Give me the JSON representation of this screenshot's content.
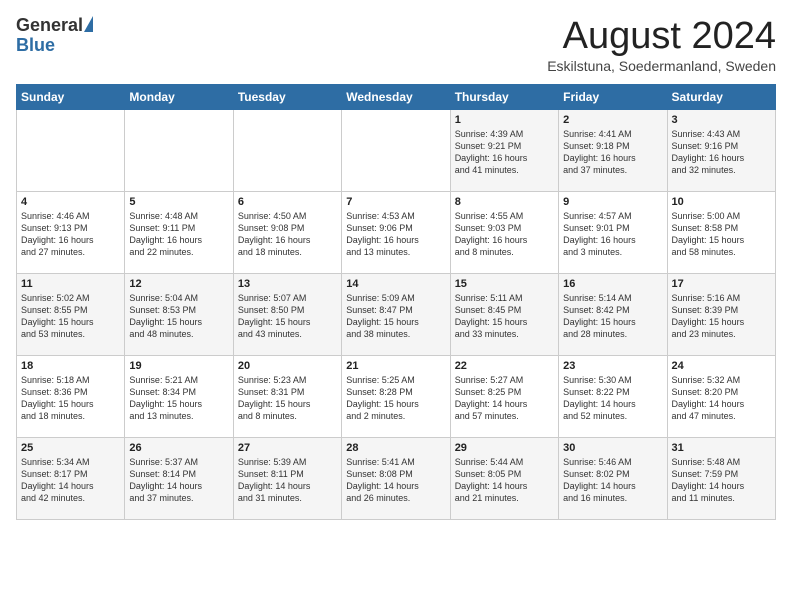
{
  "header": {
    "logo_general": "General",
    "logo_blue": "Blue",
    "title": "August 2024",
    "location": "Eskilstuna, Soedermanland, Sweden"
  },
  "days_of_week": [
    "Sunday",
    "Monday",
    "Tuesday",
    "Wednesday",
    "Thursday",
    "Friday",
    "Saturday"
  ],
  "weeks": [
    [
      {
        "day": "",
        "info": ""
      },
      {
        "day": "",
        "info": ""
      },
      {
        "day": "",
        "info": ""
      },
      {
        "day": "",
        "info": ""
      },
      {
        "day": "1",
        "info": "Sunrise: 4:39 AM\nSunset: 9:21 PM\nDaylight: 16 hours\nand 41 minutes."
      },
      {
        "day": "2",
        "info": "Sunrise: 4:41 AM\nSunset: 9:18 PM\nDaylight: 16 hours\nand 37 minutes."
      },
      {
        "day": "3",
        "info": "Sunrise: 4:43 AM\nSunset: 9:16 PM\nDaylight: 16 hours\nand 32 minutes."
      }
    ],
    [
      {
        "day": "4",
        "info": "Sunrise: 4:46 AM\nSunset: 9:13 PM\nDaylight: 16 hours\nand 27 minutes."
      },
      {
        "day": "5",
        "info": "Sunrise: 4:48 AM\nSunset: 9:11 PM\nDaylight: 16 hours\nand 22 minutes."
      },
      {
        "day": "6",
        "info": "Sunrise: 4:50 AM\nSunset: 9:08 PM\nDaylight: 16 hours\nand 18 minutes."
      },
      {
        "day": "7",
        "info": "Sunrise: 4:53 AM\nSunset: 9:06 PM\nDaylight: 16 hours\nand 13 minutes."
      },
      {
        "day": "8",
        "info": "Sunrise: 4:55 AM\nSunset: 9:03 PM\nDaylight: 16 hours\nand 8 minutes."
      },
      {
        "day": "9",
        "info": "Sunrise: 4:57 AM\nSunset: 9:01 PM\nDaylight: 16 hours\nand 3 minutes."
      },
      {
        "day": "10",
        "info": "Sunrise: 5:00 AM\nSunset: 8:58 PM\nDaylight: 15 hours\nand 58 minutes."
      }
    ],
    [
      {
        "day": "11",
        "info": "Sunrise: 5:02 AM\nSunset: 8:55 PM\nDaylight: 15 hours\nand 53 minutes."
      },
      {
        "day": "12",
        "info": "Sunrise: 5:04 AM\nSunset: 8:53 PM\nDaylight: 15 hours\nand 48 minutes."
      },
      {
        "day": "13",
        "info": "Sunrise: 5:07 AM\nSunset: 8:50 PM\nDaylight: 15 hours\nand 43 minutes."
      },
      {
        "day": "14",
        "info": "Sunrise: 5:09 AM\nSunset: 8:47 PM\nDaylight: 15 hours\nand 38 minutes."
      },
      {
        "day": "15",
        "info": "Sunrise: 5:11 AM\nSunset: 8:45 PM\nDaylight: 15 hours\nand 33 minutes."
      },
      {
        "day": "16",
        "info": "Sunrise: 5:14 AM\nSunset: 8:42 PM\nDaylight: 15 hours\nand 28 minutes."
      },
      {
        "day": "17",
        "info": "Sunrise: 5:16 AM\nSunset: 8:39 PM\nDaylight: 15 hours\nand 23 minutes."
      }
    ],
    [
      {
        "day": "18",
        "info": "Sunrise: 5:18 AM\nSunset: 8:36 PM\nDaylight: 15 hours\nand 18 minutes."
      },
      {
        "day": "19",
        "info": "Sunrise: 5:21 AM\nSunset: 8:34 PM\nDaylight: 15 hours\nand 13 minutes."
      },
      {
        "day": "20",
        "info": "Sunrise: 5:23 AM\nSunset: 8:31 PM\nDaylight: 15 hours\nand 8 minutes."
      },
      {
        "day": "21",
        "info": "Sunrise: 5:25 AM\nSunset: 8:28 PM\nDaylight: 15 hours\nand 2 minutes."
      },
      {
        "day": "22",
        "info": "Sunrise: 5:27 AM\nSunset: 8:25 PM\nDaylight: 14 hours\nand 57 minutes."
      },
      {
        "day": "23",
        "info": "Sunrise: 5:30 AM\nSunset: 8:22 PM\nDaylight: 14 hours\nand 52 minutes."
      },
      {
        "day": "24",
        "info": "Sunrise: 5:32 AM\nSunset: 8:20 PM\nDaylight: 14 hours\nand 47 minutes."
      }
    ],
    [
      {
        "day": "25",
        "info": "Sunrise: 5:34 AM\nSunset: 8:17 PM\nDaylight: 14 hours\nand 42 minutes."
      },
      {
        "day": "26",
        "info": "Sunrise: 5:37 AM\nSunset: 8:14 PM\nDaylight: 14 hours\nand 37 minutes."
      },
      {
        "day": "27",
        "info": "Sunrise: 5:39 AM\nSunset: 8:11 PM\nDaylight: 14 hours\nand 31 minutes."
      },
      {
        "day": "28",
        "info": "Sunrise: 5:41 AM\nSunset: 8:08 PM\nDaylight: 14 hours\nand 26 minutes."
      },
      {
        "day": "29",
        "info": "Sunrise: 5:44 AM\nSunset: 8:05 PM\nDaylight: 14 hours\nand 21 minutes."
      },
      {
        "day": "30",
        "info": "Sunrise: 5:46 AM\nSunset: 8:02 PM\nDaylight: 14 hours\nand 16 minutes."
      },
      {
        "day": "31",
        "info": "Sunrise: 5:48 AM\nSunset: 7:59 PM\nDaylight: 14 hours\nand 11 minutes."
      }
    ]
  ]
}
